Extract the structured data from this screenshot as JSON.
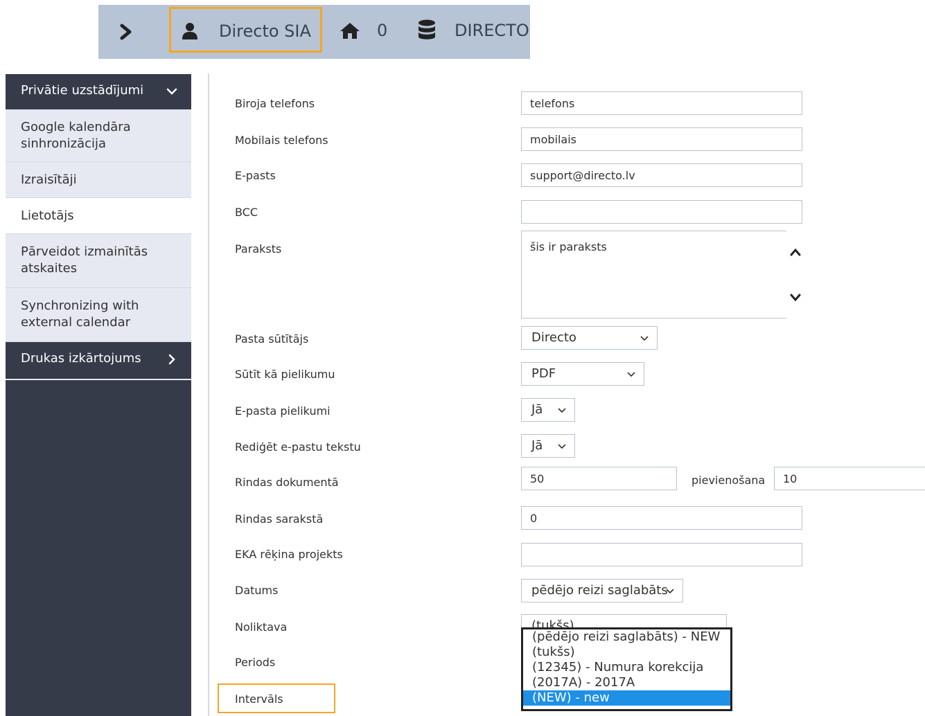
{
  "topbar": {
    "company": "Directo SIA",
    "home_count": "0",
    "database": "DIRECTO"
  },
  "sidebar": {
    "section1_title": "Privātie uzstādījumi",
    "items": [
      {
        "label": "Google kalendāra sinhronizācija"
      },
      {
        "label": "Izraisītāji"
      },
      {
        "label": "Lietotājs",
        "active": true
      },
      {
        "label": "Pārveidot izmainītās atskaites"
      },
      {
        "label": "Synchronizing with external calendar"
      }
    ],
    "section2_title": "Drukas izkārtojums"
  },
  "form": {
    "office_phone": {
      "label": "Biroja telefons",
      "value": "telefons"
    },
    "mobile_phone": {
      "label": "Mobilais telefons",
      "value": "mobilais"
    },
    "email": {
      "label": "E-pasts",
      "value": "support@directo.lv"
    },
    "bcc": {
      "label": "BCC",
      "value": ""
    },
    "signature": {
      "label": "Paraksts",
      "value": "šis ir paraksts"
    },
    "mail_sender": {
      "label": "Pasta sūtītājs",
      "value": "Directo"
    },
    "send_as_attachment": {
      "label": "Sūtīt kā pielikumu",
      "value": "PDF"
    },
    "email_attachments": {
      "label": "E-pasta pielikumi",
      "value": "Jā"
    },
    "edit_email_text": {
      "label": "Rediģēt e-pastu tekstu",
      "value": "Jā"
    },
    "rows_in_document": {
      "label": "Rindas dokumentā",
      "value": "50",
      "extra_label": "pievienošana",
      "extra_value": "10"
    },
    "rows_in_list": {
      "label": "Rindas sarakstā",
      "value": "0"
    },
    "eka_invoice_project": {
      "label": "EKA rēķina projekts",
      "value": ""
    },
    "date": {
      "label": "Datums",
      "value": "pēdējo reizi saglabāts"
    },
    "warehouse": {
      "label": "Noliktava",
      "value": "(tukšs)"
    },
    "period": {
      "label": "Periods"
    },
    "interval": {
      "label": "Intervāls"
    }
  },
  "dropdown": {
    "options": [
      "(pēdējo reizi saglabāts) - NEW",
      "(tukšs)",
      "(12345) - Numura korekcija",
      "(2017A) - 2017A",
      "(NEW) - new"
    ],
    "selected_index": 4
  },
  "colors": {
    "topbar_bg": "#b7c4d6",
    "sidebar_bg": "#363b4a",
    "highlight": "#f5a623",
    "selected_option": "#1e90e6"
  }
}
